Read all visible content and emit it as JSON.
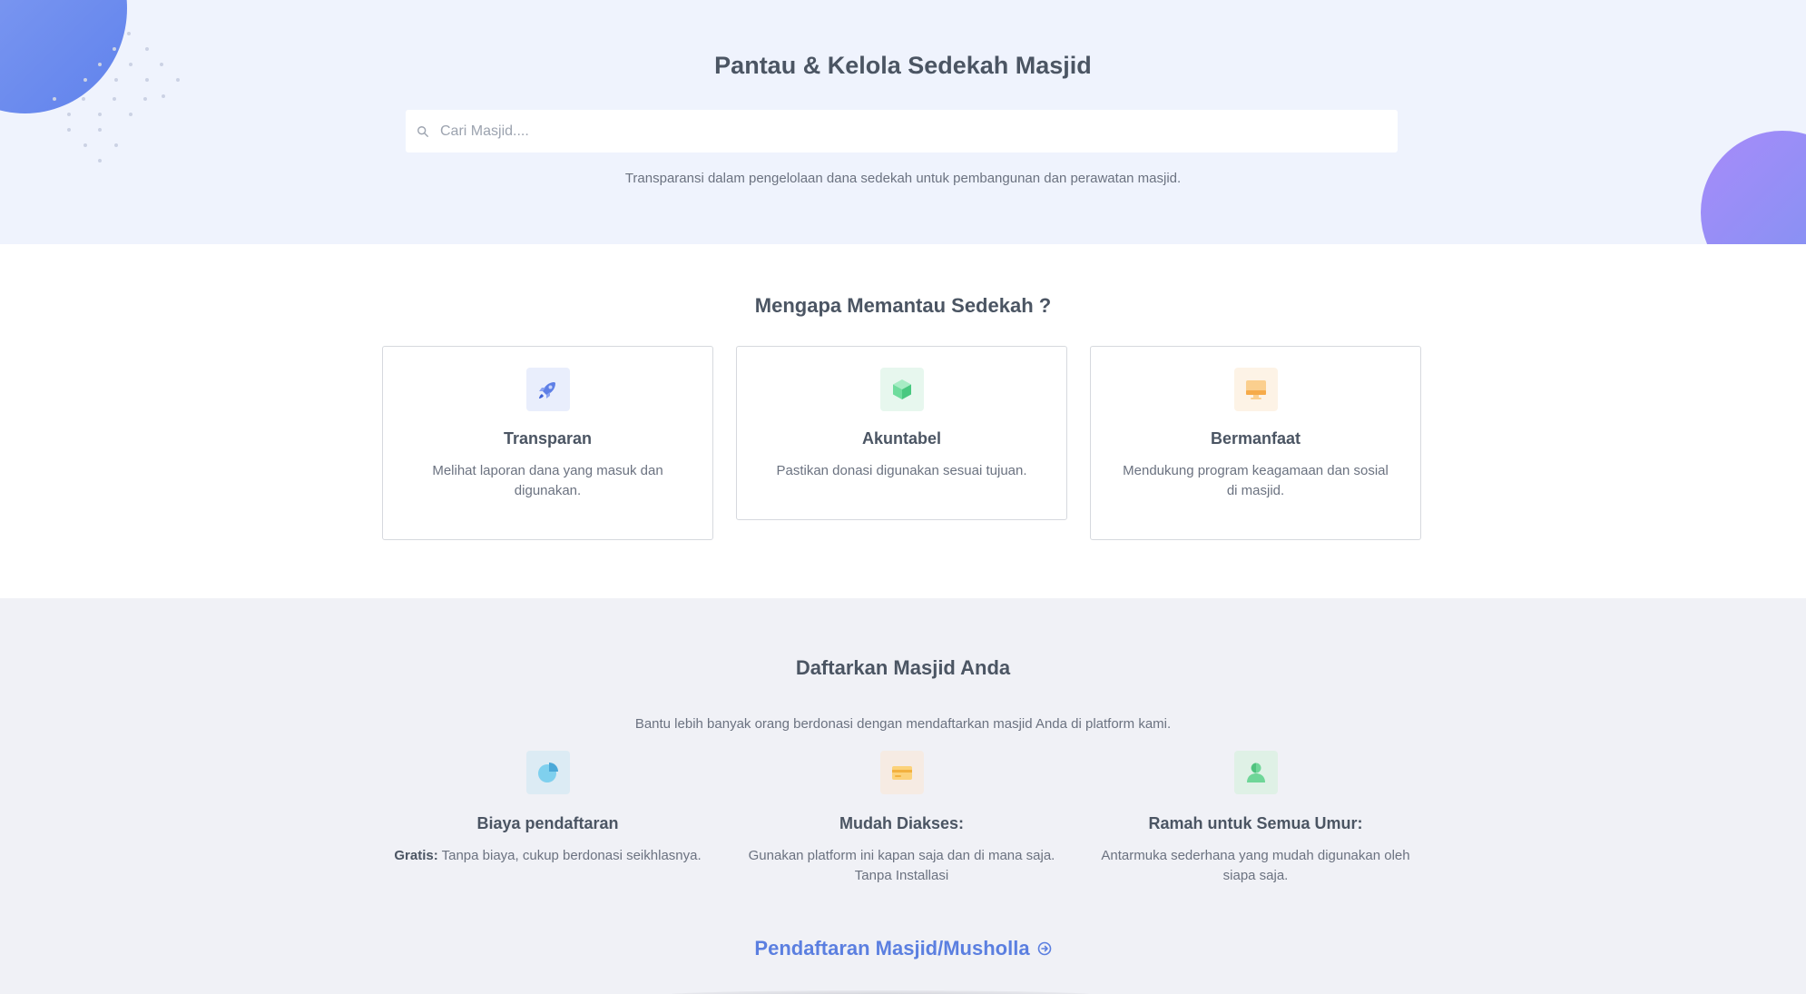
{
  "hero": {
    "title": "Pantau & Kelola Sedekah Masjid",
    "search_placeholder": "Cari Masjid....",
    "subtitle": "Transparansi dalam pengelolaan dana sedekah untuk pembangunan dan perawatan masjid."
  },
  "why": {
    "title": "Mengapa Memantau Sedekah ?",
    "cards": [
      {
        "icon": "rocket-icon",
        "title": "Transparan",
        "text": "Melihat laporan dana yang masuk dan digunakan."
      },
      {
        "icon": "cube-icon",
        "title": "Akuntabel",
        "text": "Pastikan donasi digunakan sesuai tujuan."
      },
      {
        "icon": "monitor-icon",
        "title": "Bermanfaat",
        "text": "Mendukung program keagamaan dan sosial di masjid."
      }
    ]
  },
  "register": {
    "title": "Daftarkan Masjid Anda",
    "subtitle": "Bantu lebih banyak orang berdonasi dengan mendaftarkan masjid Anda di platform kami.",
    "features": [
      {
        "icon": "pie-chart-icon",
        "title": "Biaya pendaftaran",
        "bold": "Gratis:",
        "text": " Tanpa biaya, cukup berdonasi seikhlasnya."
      },
      {
        "icon": "credit-card-icon",
        "title": "Mudah Diakses:",
        "text": "Gunakan platform ini kapan saja dan di mana saja. Tanpa Installasi"
      },
      {
        "icon": "user-icon",
        "title": "Ramah untuk Semua Umur:",
        "text": "Antarmuka sederhana yang mudah digunakan oleh siapa saja."
      }
    ],
    "cta_label": "Pendaftaran Masjid/Musholla"
  },
  "colors": {
    "hero_bg": "#eff3fd",
    "register_bg": "#f0f1f6",
    "accent": "#5b7fe0"
  }
}
